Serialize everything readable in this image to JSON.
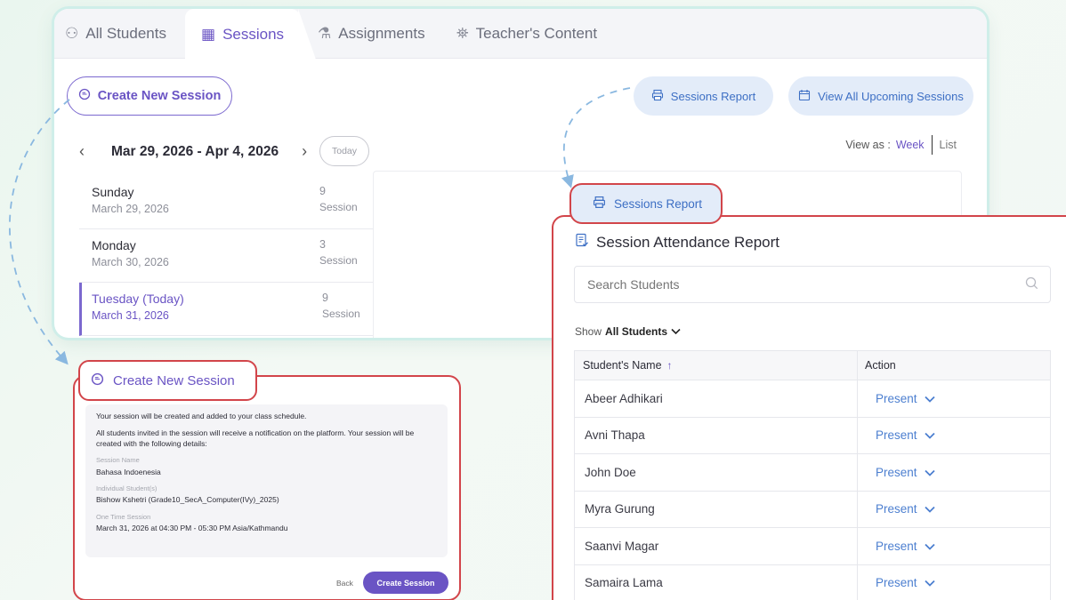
{
  "tabs": [
    {
      "label": "All Students",
      "icon": "students-icon"
    },
    {
      "label": "Sessions",
      "icon": "calendar-icon",
      "active": true
    },
    {
      "label": "Assignments",
      "icon": "flask-icon"
    },
    {
      "label": "Teacher's Content",
      "icon": "teacher-icon"
    }
  ],
  "toolbar": {
    "create_new_session": "Create New Session",
    "sessions_report": "Sessions Report",
    "view_all_upcoming": "View All Upcoming Sessions"
  },
  "calendar": {
    "range": "Mar 29, 2026 - Apr 4, 2026",
    "today_label": "Today",
    "view_as_label": "View as :",
    "view_week": "Week",
    "view_list": "List",
    "days": [
      {
        "name": "Sunday",
        "date": "March 29, 2026",
        "count": "9",
        "unit": "Session"
      },
      {
        "name": "Monday",
        "date": "March 30, 2026",
        "count": "3",
        "unit": "Session"
      },
      {
        "name": "Tuesday (Today)",
        "date": "March 31, 2026",
        "count": "9",
        "unit": "Session",
        "active": true
      }
    ]
  },
  "create_session": {
    "title": "Create New Session",
    "intro": "Your session will be created and added to your class schedule.",
    "notice": "All students invited in the session will receive a notification on the platform. Your session will be created with the following details:",
    "session_name_label": "Session Name",
    "session_name": "Bahasa Indoenesia",
    "students_label": "Individual Student(s)",
    "students": "Bishow Kshetri (Grade10_SecA_Computer(IVy)_2025)",
    "time_label": "One Time Session",
    "time": "March 31, 2026 at 04:30 PM - 05:30 PM Asia/Kathmandu",
    "back": "Back",
    "submit": "Create Session"
  },
  "report": {
    "button_label": "Sessions Report",
    "title": "Session Attendance Report",
    "search_placeholder": "Search Students",
    "show_label": "Show",
    "show_value": "All Students",
    "col_name": "Student's Name",
    "col_action": "Action",
    "rows": [
      {
        "name": "Abeer Adhikari",
        "action": "Present"
      },
      {
        "name": "Avni Thapa",
        "action": "Present"
      },
      {
        "name": "John Doe",
        "action": "Present"
      },
      {
        "name": "Myra Gurung",
        "action": "Present"
      },
      {
        "name": "Saanvi Magar",
        "action": "Present"
      },
      {
        "name": "Samaira Lama",
        "action": "Present"
      }
    ]
  },
  "colors": {
    "accent_purple": "#6a54c4",
    "accent_blue": "#3d6fc4",
    "highlight_red": "#d2454a",
    "connector_blue": "#8ab8e0"
  }
}
